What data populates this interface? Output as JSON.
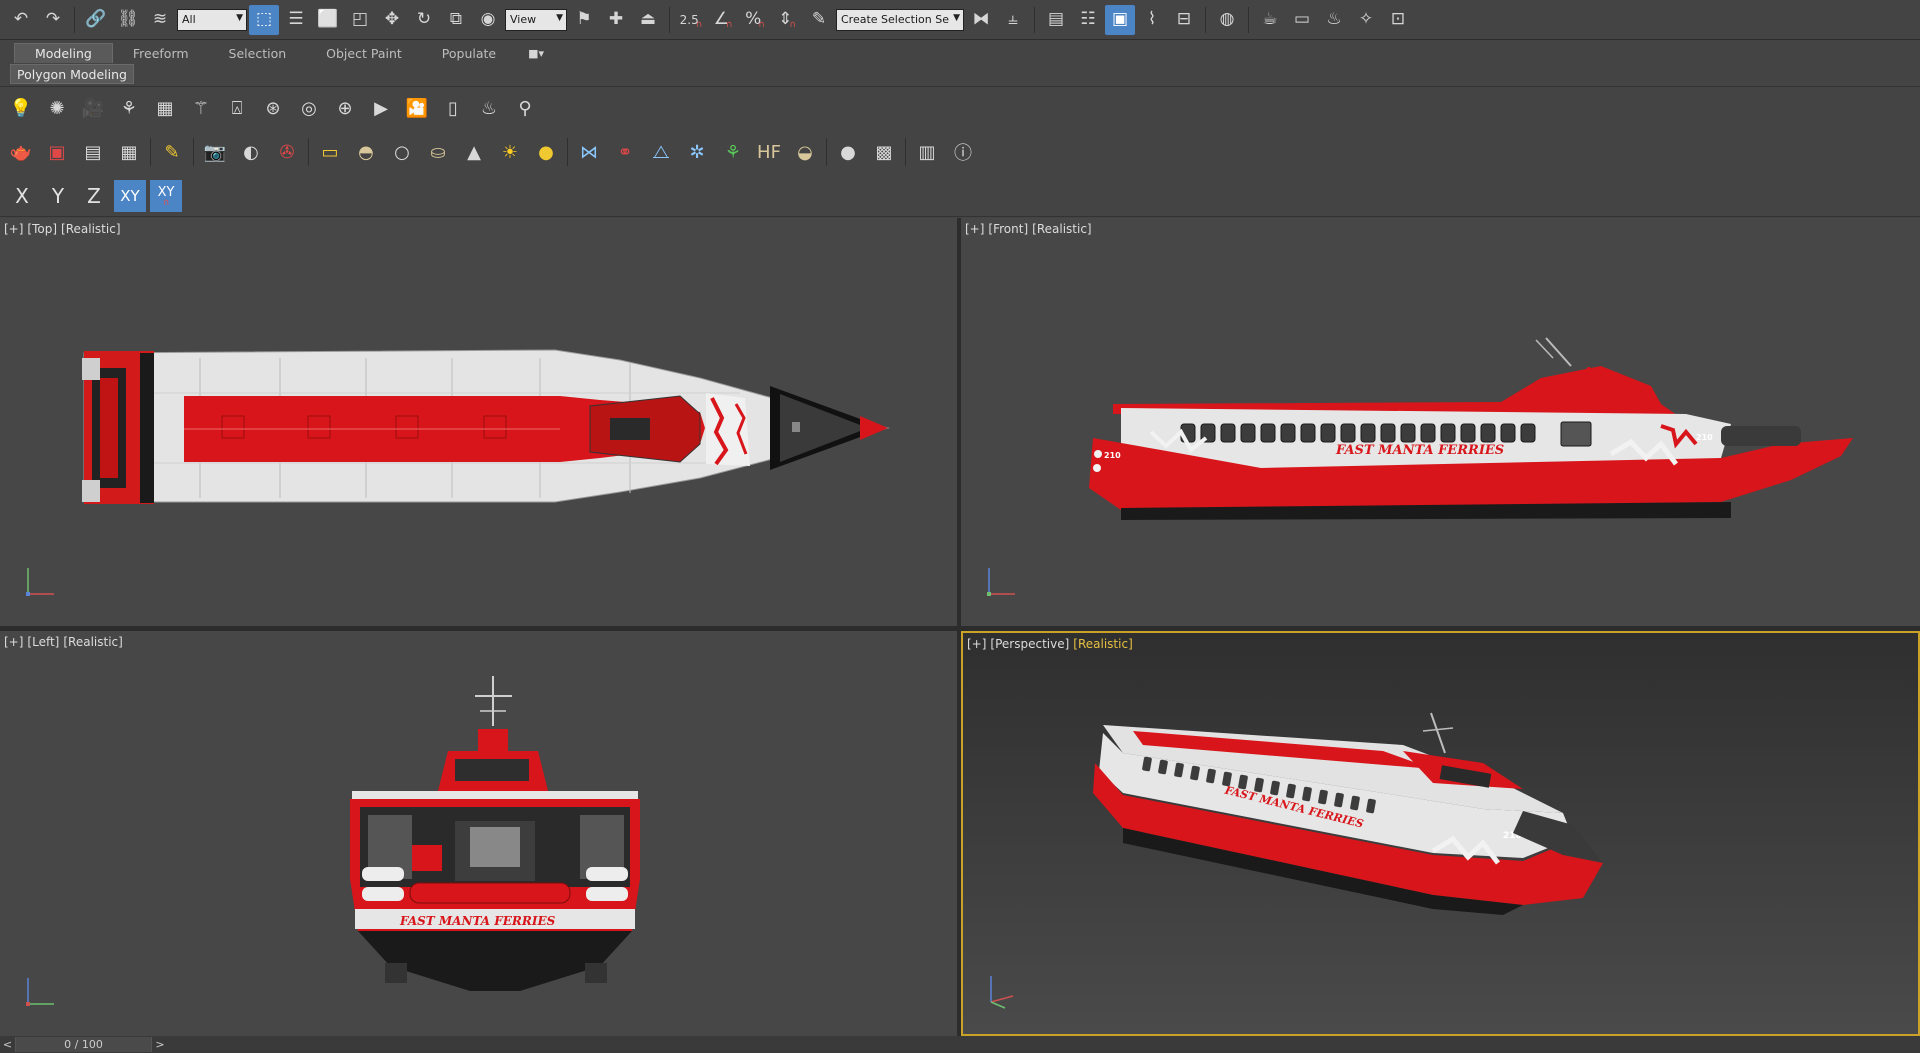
{
  "main_toolbar": {
    "selection_filter": "All",
    "ref_coord_system": "View",
    "snap_value": "2.5",
    "named_selection_placeholder": "Create Selection Se",
    "icons": [
      "undo-icon",
      "redo-icon",
      "link-icon",
      "unlink-icon",
      "bind-space-warp-icon",
      "select-object-icon",
      "select-by-name-icon",
      "rect-region-icon",
      "window-crossing-icon",
      "move-icon",
      "rotate-icon",
      "scale-icon",
      "pivot-center-icon",
      "select-manipulate-icon",
      "keyboard-shortcut-icon",
      "snaps-toggle-icon",
      "angle-snap-icon",
      "percent-snap-icon",
      "spinner-snap-icon",
      "edit-named-selection-icon",
      "mirror-icon",
      "align-icon",
      "layer-explorer-icon",
      "scene-explorer-icon",
      "ribbon-toggle-icon",
      "curve-editor-icon",
      "schematic-view-icon",
      "material-editor-icon",
      "render-setup-icon",
      "rendered-frame-icon",
      "render-icon",
      "render-iterative-icon",
      "render-cloud-icon"
    ]
  },
  "ribbon": {
    "tabs": [
      "Modeling",
      "Freeform",
      "Selection",
      "Object Paint",
      "Populate"
    ],
    "active_tab": "Modeling",
    "panel_label": "Polygon Modeling"
  },
  "axis_constraints": {
    "x": "X",
    "y": "Y",
    "z": "Z",
    "xy": "XY",
    "xy_lock": "XY"
  },
  "viewports": {
    "top": {
      "plus": "[+]",
      "view": "[Top]",
      "shading": "[Realistic]"
    },
    "front": {
      "plus": "[+]",
      "view": "[Front]",
      "shading": "[Realistic]"
    },
    "left": {
      "plus": "[+]",
      "view": "[Left]",
      "shading": "[Realistic]"
    },
    "perspective": {
      "plus": "[+]",
      "view": "[Perspective]",
      "shading": "[Realistic]"
    }
  },
  "boat": {
    "livery_text": "FAST MANTA FERRIES",
    "hull_number": "210"
  },
  "timeline": {
    "frame": "0 / 100",
    "prev": "<",
    "next": ">"
  },
  "colors": {
    "ui_bg": "#444444",
    "active_blue": "#4b85c6",
    "active_viewport_border": "#c9a227",
    "boat_red": "#d8151a",
    "boat_white": "#e8e8e8"
  }
}
